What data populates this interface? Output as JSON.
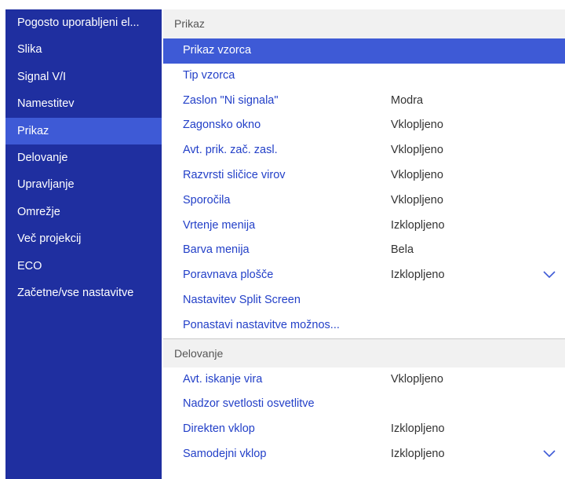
{
  "sidebar": {
    "items": [
      {
        "label": "Pogosto uporabljeni el...",
        "active": false
      },
      {
        "label": "Slika",
        "active": false
      },
      {
        "label": "Signal V/I",
        "active": false
      },
      {
        "label": "Namestitev",
        "active": false
      },
      {
        "label": "Prikaz",
        "active": true
      },
      {
        "label": "Delovanje",
        "active": false
      },
      {
        "label": "Upravljanje",
        "active": false
      },
      {
        "label": "Omrežje",
        "active": false
      },
      {
        "label": "Več projekcij",
        "active": false
      },
      {
        "label": "ECO",
        "active": false
      },
      {
        "label": "Začetne/vse nastavitve",
        "active": false
      }
    ]
  },
  "sections": [
    {
      "header": "Prikaz",
      "rows": [
        {
          "label": "Prikaz vzorca",
          "value": "",
          "selected": true,
          "chevron": false
        },
        {
          "label": "Tip vzorca",
          "value": "",
          "selected": false,
          "chevron": false
        },
        {
          "label": "Zaslon \"Ni signala\"",
          "value": "Modra",
          "selected": false,
          "chevron": false
        },
        {
          "label": "Zagonsko okno",
          "value": "Vklopljeno",
          "selected": false,
          "chevron": false
        },
        {
          "label": "Avt. prik. zač. zasl.",
          "value": "Vklopljeno",
          "selected": false,
          "chevron": false
        },
        {
          "label": "Razvrsti sličice virov",
          "value": "Vklopljeno",
          "selected": false,
          "chevron": false
        },
        {
          "label": "Sporočila",
          "value": "Vklopljeno",
          "selected": false,
          "chevron": false
        },
        {
          "label": "Vrtenje menija",
          "value": "Izklopljeno",
          "selected": false,
          "chevron": false
        },
        {
          "label": "Barva menija",
          "value": "Bela",
          "selected": false,
          "chevron": false
        },
        {
          "label": "Poravnava plošče",
          "value": "Izklopljeno",
          "selected": false,
          "chevron": true
        },
        {
          "label": "Nastavitev Split Screen",
          "value": "",
          "selected": false,
          "chevron": false
        },
        {
          "label": "Ponastavi nastavitve možnos...",
          "value": "",
          "selected": false,
          "chevron": false
        }
      ]
    },
    {
      "header": "Delovanje",
      "rows": [
        {
          "label": "Avt. iskanje vira",
          "value": "Vklopljeno",
          "selected": false,
          "chevron": false
        },
        {
          "label": "Nadzor svetlosti osvetlitve",
          "value": "",
          "selected": false,
          "chevron": false
        },
        {
          "label": "Direkten vklop",
          "value": "Izklopljeno",
          "selected": false,
          "chevron": false
        },
        {
          "label": "Samodejni vklop",
          "value": "Izklopljeno",
          "selected": false,
          "chevron": true
        }
      ]
    }
  ],
  "icons": {
    "chevron": "chevron-down-icon"
  },
  "colors": {
    "sidebar_bg": "#1f2fa0",
    "highlight": "#3e5ad6",
    "label_text": "#2340c8",
    "value_text": "#333333",
    "header_bg": "#f1f1f1"
  }
}
